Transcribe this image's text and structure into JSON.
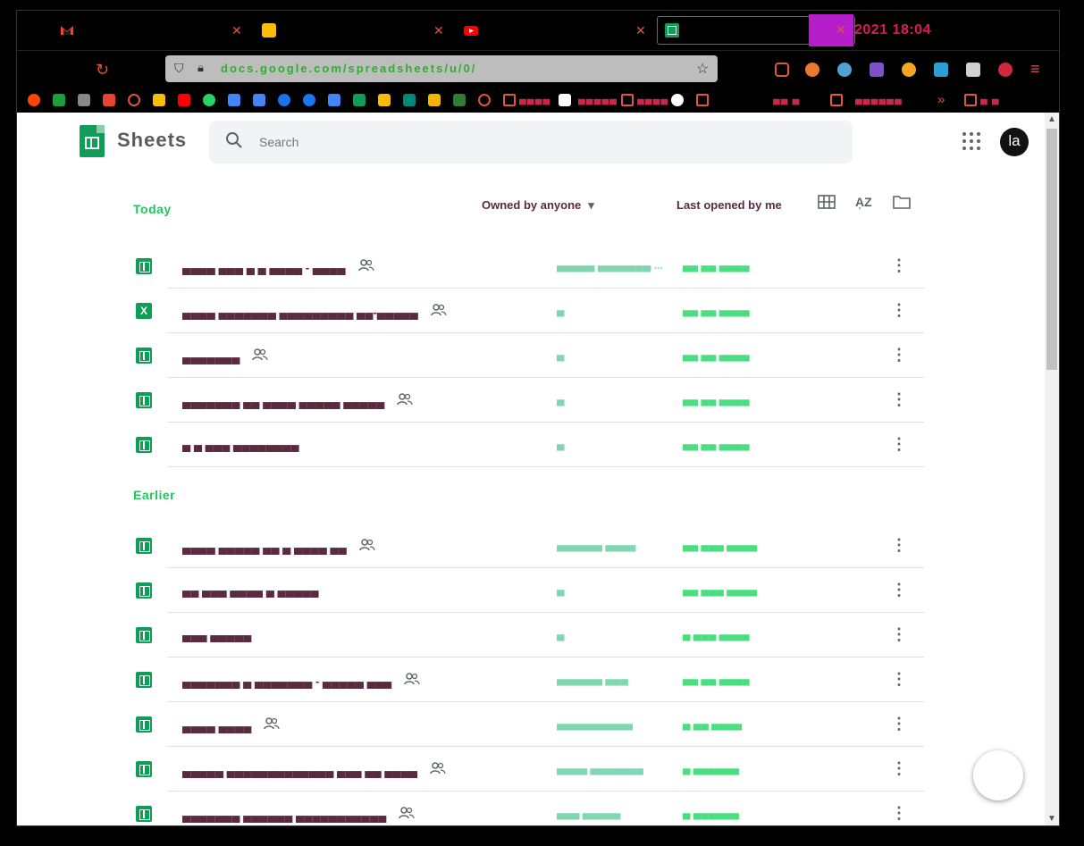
{
  "tabs": [
    {
      "title": "",
      "icon": "gmail-icon",
      "close": "✕"
    },
    {
      "title": "",
      "icon": "keep-icon",
      "close": "✕"
    },
    {
      "title": "",
      "icon": "youtube-icon",
      "close": "✕"
    },
    {
      "title": "",
      "icon": "sheets-icon",
      "close": "✕"
    }
  ],
  "clock": "2021 18:04",
  "address_bar": {
    "url": "docs.google.com/spreadsheets/u/0/"
  },
  "bookmarks": {
    "folder1": "▄▄▄▄",
    "folder2": "▄▄▄▄▄",
    "folder3": "▄▄▄▄",
    "folder4": "▄▄ ▄",
    "folder5": "▄▄▄▄▄▄",
    "folder6": "▄ ▄"
  },
  "header": {
    "app_title": "Sheets",
    "search_placeholder": "Search",
    "avatar": "la"
  },
  "recent": {
    "section_title": "Today",
    "owner_filter": "Owned by anyone",
    "sort_label": "Last opened by me"
  },
  "earlier": {
    "section_title": "Earlier"
  },
  "files_recent": [
    {
      "name": "▄▄▄▄ ▄▄▄ ▄ ▄ ▄▄▄▄ - ▄▄▄▄",
      "shared": true,
      "owner": "▄▄▄▄▄ ▄▄▄▄▄▄▄ ...",
      "date": "▄▄ ▄▄ ▄▄▄▄",
      "type": "sheet"
    },
    {
      "name": "▄▄▄▄ ▄▄▄▄▄▄▄ ▄▄▄▄▄▄▄▄▄ ▄▄-▄▄▄▄▄",
      "shared": true,
      "owner": "▄",
      "date": "▄▄ ▄▄ ▄▄▄▄",
      "type": "excel"
    },
    {
      "name": "▄▄▄▄▄▄▄",
      "shared": true,
      "owner": "▄",
      "date": "▄▄ ▄▄ ▄▄▄▄",
      "type": "sheet"
    },
    {
      "name": "▄▄▄▄▄▄▄ ▄▄ ▄▄▄▄ ▄▄▄▄▄ ▄▄▄▄▄",
      "shared": true,
      "owner": "▄",
      "date": "▄▄ ▄▄ ▄▄▄▄",
      "type": "sheet"
    },
    {
      "name": "▄ ▄ ▄▄▄ ▄▄▄▄▄▄▄▄",
      "shared": false,
      "owner": "▄",
      "date": "▄▄ ▄▄ ▄▄▄▄",
      "type": "sheet"
    }
  ],
  "files_earlier": [
    {
      "name": "▄▄▄▄ ▄▄▄▄▄ ▄▄ ▄ ▄▄▄▄ ▄▄",
      "shared": true,
      "owner": "▄▄▄▄▄▄ ▄▄▄▄",
      "date": "▄▄ ▄▄▄ ▄▄▄▄",
      "type": "sheet"
    },
    {
      "name": "▄▄ ▄▄▄ ▄▄▄▄ ▄ ▄▄▄▄▄",
      "shared": false,
      "owner": "▄",
      "date": "▄▄ ▄▄▄ ▄▄▄▄",
      "type": "sheet"
    },
    {
      "name": "▄▄▄ ▄▄▄▄▄",
      "shared": false,
      "owner": "▄",
      "date": "▄ ▄▄▄ ▄▄▄▄",
      "type": "sheet"
    },
    {
      "name": "▄▄▄▄▄▄▄ ▄ ▄▄▄▄▄▄▄ - ▄▄▄▄▄ ▄▄▄",
      "shared": true,
      "owner": "▄▄▄▄▄▄ ▄▄▄",
      "date": "▄▄ ▄▄ ▄▄▄▄",
      "type": "sheet"
    },
    {
      "name": "▄▄▄▄ ▄▄▄▄",
      "shared": true,
      "owner": "▄▄▄▄▄▄▄▄▄▄",
      "date": "▄ ▄▄ ▄▄▄▄",
      "type": "sheet"
    },
    {
      "name": "▄▄▄▄▄ ▄▄▄▄▄▄▄▄▄▄▄▄▄ ▄▄▄ ▄▄ ▄▄▄▄",
      "shared": true,
      "owner": "▄▄▄▄ ▄▄▄▄▄▄▄",
      "date": "▄ ▄▄▄▄▄▄",
      "type": "sheet"
    },
    {
      "name": "▄▄▄▄▄▄▄ ▄▄▄▄▄▄ ▄▄▄▄▄▄▄▄▄▄▄",
      "shared": true,
      "owner": "▄▄▄ ▄▄▄▄▄",
      "date": "▄ ▄▄▄▄▄▄",
      "type": "sheet"
    }
  ]
}
